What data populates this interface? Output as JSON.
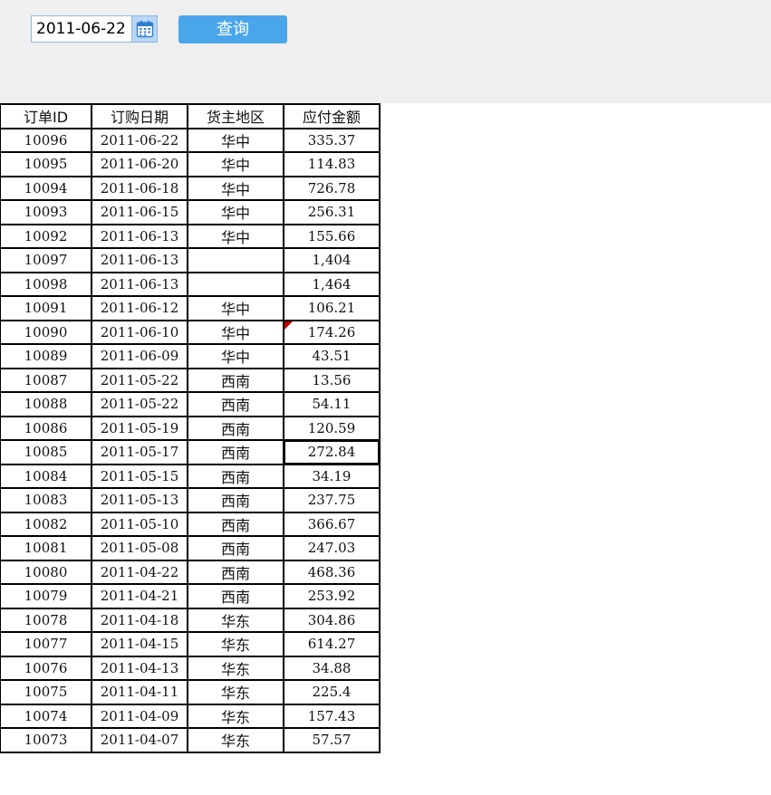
{
  "toolbar": {
    "date_value": "2011-06-22",
    "query_label": "查询"
  },
  "icons": {
    "calendar": "calendar-icon",
    "comment": "comment-indicator-icon"
  },
  "colors": {
    "toolbar_bg": "#efefef",
    "query_button": "#4aa6ea",
    "calendar_button": "#b9d6f5",
    "comment_marker": "#c00000"
  },
  "table": {
    "headers": [
      "订单ID",
      "订购日期",
      "货主地区",
      "应付金额"
    ],
    "rows": [
      [
        "10096",
        "2011-06-22",
        "华中",
        "335.37"
      ],
      [
        "10095",
        "2011-06-20",
        "华中",
        "114.83"
      ],
      [
        "10094",
        "2011-06-18",
        "华中",
        "726.78"
      ],
      [
        "10093",
        "2011-06-15",
        "华中",
        "256.31"
      ],
      [
        "10092",
        "2011-06-13",
        "华中",
        "155.66"
      ],
      [
        "10097",
        "2011-06-13",
        "",
        "1,404"
      ],
      [
        "10098",
        "2011-06-13",
        "",
        "1,464"
      ],
      [
        "10091",
        "2011-06-12",
        "华中",
        "106.21"
      ],
      [
        "10090",
        "2011-06-10",
        "华中",
        "174.26"
      ],
      [
        "10089",
        "2011-06-09",
        "华中",
        "43.51"
      ],
      [
        "10087",
        "2011-05-22",
        "西南",
        "13.56"
      ],
      [
        "10088",
        "2011-05-22",
        "西南",
        "54.11"
      ],
      [
        "10086",
        "2011-05-19",
        "西南",
        "120.59"
      ],
      [
        "10085",
        "2011-05-17",
        "西南",
        "272.84"
      ],
      [
        "10084",
        "2011-05-15",
        "西南",
        "34.19"
      ],
      [
        "10083",
        "2011-05-13",
        "西南",
        "237.75"
      ],
      [
        "10082",
        "2011-05-10",
        "西南",
        "366.67"
      ],
      [
        "10081",
        "2011-05-08",
        "西南",
        "247.03"
      ],
      [
        "10080",
        "2011-04-22",
        "西南",
        "468.36"
      ],
      [
        "10079",
        "2011-04-21",
        "西南",
        "253.92"
      ],
      [
        "10078",
        "2011-04-18",
        "华东",
        "304.86"
      ],
      [
        "10077",
        "2011-04-15",
        "华东",
        "614.27"
      ],
      [
        "10076",
        "2011-04-13",
        "华东",
        "34.88"
      ],
      [
        "10075",
        "2011-04-11",
        "华东",
        "225.4"
      ],
      [
        "10074",
        "2011-04-09",
        "华东",
        "157.43"
      ],
      [
        "10073",
        "2011-04-07",
        "华东",
        "57.57"
      ]
    ],
    "selected_row": 13,
    "comment_row": 8
  }
}
